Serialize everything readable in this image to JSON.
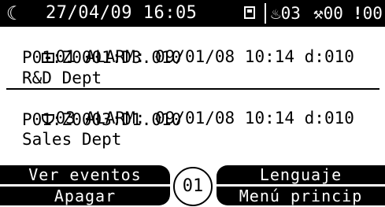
{
  "status": {
    "datetime": "27/04/09 16:05",
    "icons": {
      "moon": "moon-icon",
      "battery": "battery-icon",
      "fire": "fire-icon",
      "wrench": "wrench-icon",
      "alert": "exclamation-icon"
    },
    "fire_count": "03",
    "fault_count": "00",
    "alarm_count": "00"
  },
  "events": [
    {
      "icon": "panel-icon",
      "header": "01 ALARM: 09/01/08 10:14 d:010",
      "address": "P01:Z0001:D3.010",
      "location": "R&D Dept"
    },
    {
      "icon": "shield-icon",
      "header": "03 ALARM: 09/01/08 10:14 d:010",
      "address": "P01:Z0003:D1.010",
      "location": "Sales Dept"
    }
  ],
  "softkeys": {
    "top_left": "Ver eventos",
    "top_right": "Lenguaje",
    "bottom_left": "Apagar",
    "bottom_right": "Menú princip",
    "center": "01"
  }
}
